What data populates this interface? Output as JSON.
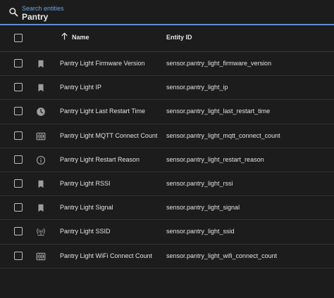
{
  "search": {
    "label": "Search entities",
    "value": "Pantry"
  },
  "columns": {
    "name": "Name",
    "entity_id": "Entity ID"
  },
  "rows": [
    {
      "icon": "bookmark-icon",
      "name": "Pantry Light Firmware Version",
      "entity_id": "sensor.pantry_light_firmware_version"
    },
    {
      "icon": "bookmark-icon",
      "name": "Pantry Light IP",
      "entity_id": "sensor.pantry_light_ip"
    },
    {
      "icon": "clock-icon",
      "name": "Pantry Light Last Restart Time",
      "entity_id": "sensor.pantry_light_last_restart_time"
    },
    {
      "icon": "counter-icon",
      "name": "Pantry Light MQTT Connect Count",
      "entity_id": "sensor.pantry_light_mqtt_connect_count"
    },
    {
      "icon": "information-icon",
      "name": "Pantry Light Restart Reason",
      "entity_id": "sensor.pantry_light_restart_reason"
    },
    {
      "icon": "bookmark-icon",
      "name": "Pantry Light RSSI",
      "entity_id": "sensor.pantry_light_rssi"
    },
    {
      "icon": "bookmark-icon",
      "name": "Pantry Light Signal",
      "entity_id": "sensor.pantry_light_signal"
    },
    {
      "icon": "access-point-icon",
      "name": "Pantry Light SSID",
      "entity_id": "sensor.pantry_light_ssid"
    },
    {
      "icon": "counter-icon",
      "name": "Pantry Light WiFi Connect Count",
      "entity_id": "sensor.pantry_light_wifi_connect_count"
    }
  ],
  "colors": {
    "background": "#1c1c1c",
    "accent": "#5f8fd6",
    "icon": "#9e9e9e"
  }
}
